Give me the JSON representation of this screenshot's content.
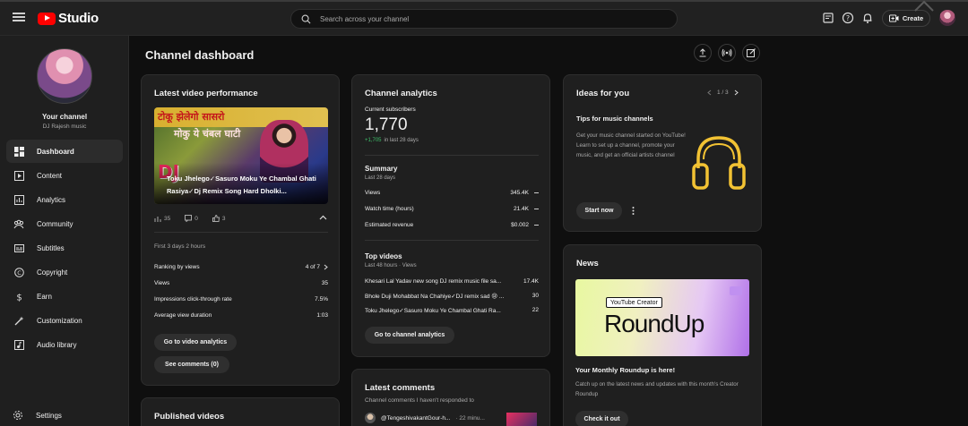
{
  "topbar": {
    "logo_text": "Studio",
    "search_placeholder": "Search across your channel",
    "create_label": "Create",
    "colors": {
      "brand_red": "#ff0000",
      "bg": "#0f0f0f",
      "surface": "#1f1f1f"
    }
  },
  "sidebar": {
    "your_channel": "Your channel",
    "channel_name": "DJ Rajesh music",
    "items": [
      {
        "label": "Dashboard",
        "icon": "dashboard-icon",
        "active": true
      },
      {
        "label": "Content",
        "icon": "content-icon"
      },
      {
        "label": "Analytics",
        "icon": "analytics-icon"
      },
      {
        "label": "Community",
        "icon": "community-icon"
      },
      {
        "label": "Subtitles",
        "icon": "subtitles-icon"
      },
      {
        "label": "Copyright",
        "icon": "copyright-icon"
      },
      {
        "label": "Earn",
        "icon": "earn-icon"
      },
      {
        "label": "Customization",
        "icon": "customization-icon"
      },
      {
        "label": "Audio library",
        "icon": "audio-library-icon"
      }
    ],
    "settings_label": "Settings"
  },
  "page": {
    "title": "Channel dashboard"
  },
  "latest_video": {
    "heading": "Latest video performance",
    "thumbnail_overlay_line1": "टोकू झेलेगो सासरो",
    "thumbnail_overlay_line2": "मोकु ये चंबल घाटी",
    "thumbnail_dj": "DJ",
    "title": "Toku Jhelego✓Sasuro Moku Ye Chambal Ghati Rasiya✓Dj Remix Song Hard Dholki...",
    "stat_views": "35",
    "stat_comments": "0",
    "stat_likes": "3",
    "period": "First 3 days 2 hours",
    "metrics": [
      {
        "label": "Ranking by views",
        "value": "4 of 7"
      },
      {
        "label": "Views",
        "value": "35"
      },
      {
        "label": "Impressions click-through rate",
        "value": "7.5%"
      },
      {
        "label": "Average view duration",
        "value": "1:03"
      }
    ],
    "btn_analytics": "Go to video analytics",
    "btn_comments": "See comments (0)"
  },
  "published": {
    "heading": "Published videos"
  },
  "analytics": {
    "heading": "Channel analytics",
    "subs_label": "Current subscribers",
    "subs_value": "1,770",
    "subs_change": "+1,705",
    "subs_change_period": "in last 28 days",
    "summary_heading": "Summary",
    "summary_period": "Last 28 days",
    "summary": [
      {
        "label": "Views",
        "value": "345.4K"
      },
      {
        "label": "Watch time (hours)",
        "value": "21.4K"
      },
      {
        "label": "Estimated revenue",
        "value": "$0.002"
      }
    ],
    "top_heading": "Top videos",
    "top_period": "Last 48 hours · Views",
    "top_videos": [
      {
        "title": "Khesari Lal Yadav new song DJ remix music file sa...",
        "views": "17.4K"
      },
      {
        "title": "Bhole Duji Mohabbat Na Chahiye✓DJ remix sad 😢 ...",
        "views": "30"
      },
      {
        "title": "Toku Jhelego✓Sasuro Moku Ye Chambal Ghati Ra...",
        "views": "22"
      }
    ],
    "btn_channel_analytics": "Go to channel analytics"
  },
  "comments": {
    "heading": "Latest comments",
    "subheading": "Channel comments I haven't responded to",
    "first_author": "@TengeshivakantGour-h...",
    "first_time": "· 22 minu..."
  },
  "ideas": {
    "heading": "Ideas for you",
    "pager": "1 / 3",
    "tip_title": "Tips for music channels",
    "tip_body": "Get your music channel started on YouTube! Learn to set up a channel, promote your music, and get an official artists channel",
    "btn_start": "Start now",
    "accent": "#f2c233"
  },
  "news": {
    "heading": "News",
    "tag": "YouTube Creator",
    "big": "RoundUp",
    "headline": "Your Monthly Roundup is here!",
    "body": "Catch up on the latest news and updates with this month's Creator Roundup",
    "btn_check": "Check it out"
  }
}
